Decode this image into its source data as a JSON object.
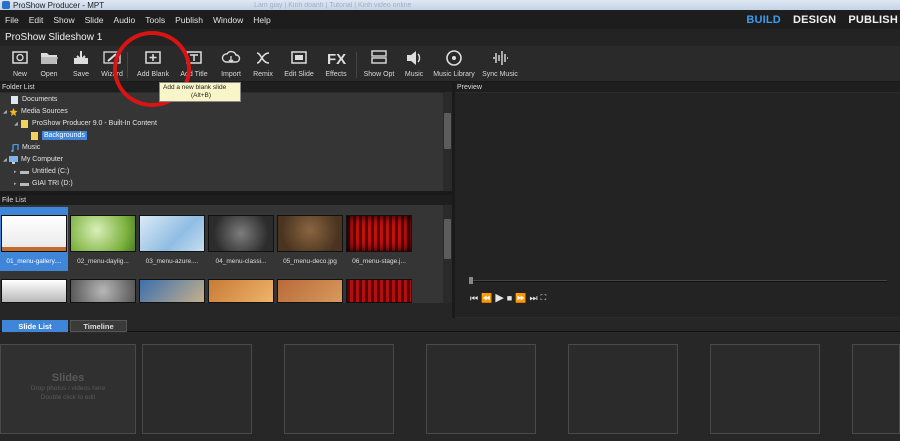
{
  "window": {
    "title": "ProShow Producer - MPT",
    "ghost_tabs": "Lam giay | Kinh doanh | Tutorial  |  Kinh video online"
  },
  "menu": [
    "File",
    "Edit",
    "Show",
    "Slide",
    "Audio",
    "Tools",
    "Publish",
    "Window",
    "Help"
  ],
  "modes": [
    {
      "label": "BUILD",
      "active": true
    },
    {
      "label": "DESIGN",
      "active": false
    },
    {
      "label": "PUBLISH",
      "active": false
    }
  ],
  "show_title": "ProShow Slideshow 1",
  "toolbar": {
    "new": "New",
    "open": "Open",
    "save": "Save",
    "wizard": "Wizard",
    "add_blank": "Add Blank",
    "add_title": "Add Title",
    "import": "Import",
    "remix": "Remix",
    "edit_slide": "Edit Slide",
    "effects": "Effects",
    "show_opt": "Show Opt",
    "music": "Music",
    "music_library": "Music Library",
    "sync_music": "Sync Music"
  },
  "tooltip": {
    "line1": "Add a new blank slide",
    "line2": "(Alt+B)"
  },
  "folder_list": {
    "header": "Folder List",
    "items": [
      "Documents",
      "Media Sources",
      "ProShow Producer 9.0 - Built-In Content",
      "Backgrounds",
      "Music",
      "My Computer",
      "Untitled (C:)",
      "GIAI TRI (D:)"
    ]
  },
  "file_list": {
    "header": "File List",
    "files": [
      "01_menu-gallery....",
      "02_menu-daylig...",
      "03_menu-azure....",
      "04_menu-classi...",
      "05_menu-deco.jpg",
      "06_menu-stage.j..."
    ]
  },
  "preview": {
    "header": "Preview"
  },
  "tabs": {
    "slide_list": "Slide List",
    "timeline": "Timeline"
  },
  "slides": {
    "title": "Slides",
    "hint1": "Drop photos / videos here",
    "hint2": "Double click to edit"
  },
  "colors": {
    "accent": "#3f86d8",
    "highlight_circle": "#d81414",
    "mode_active": "#3c9cef"
  }
}
